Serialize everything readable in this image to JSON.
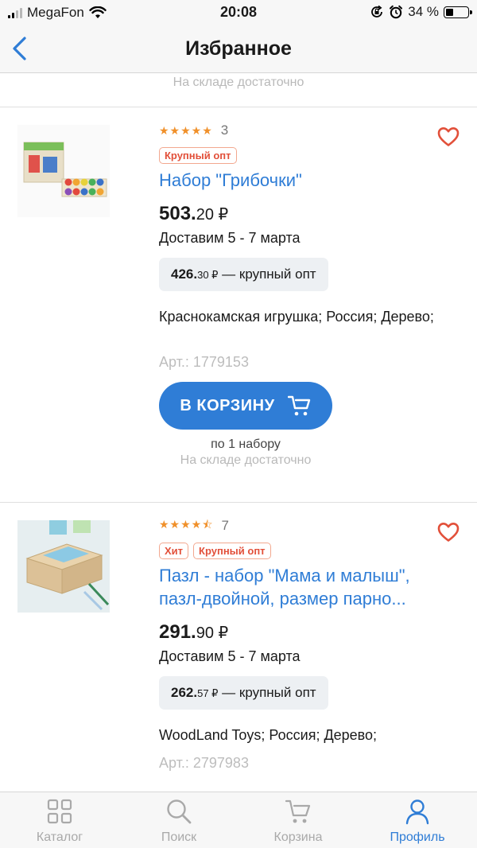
{
  "status_bar": {
    "carrier": "MegaFon",
    "time": "20:08",
    "battery": "34 %",
    "battery_level_percent": 34,
    "icons": [
      "signal-icon",
      "wifi-icon",
      "rotation-lock-icon",
      "alarm-icon",
      "battery-icon"
    ]
  },
  "nav": {
    "title": "Избранное",
    "back_icon": "chevron-left-icon"
  },
  "previous_item": {
    "stock": "На складе достаточно"
  },
  "products": [
    {
      "rating_stars": 5,
      "stars": "★★★★★",
      "rating_count": "3",
      "badges": [
        "Крупный опт"
      ],
      "name": "Набор \"Грибочки\"",
      "price_main": "503.",
      "price_kop": "20 ₽",
      "delivery": "Доставим 5 - 7 марта",
      "wholesale_main": "426.",
      "wholesale_kop": "30 ₽",
      "wholesale_label": " — крупный опт",
      "vendor": "Краснокамская игрушка; Россия; Дерево;",
      "sku": "Арт.: 1779153",
      "cart_button": "В КОРЗИНУ",
      "per_unit": "по 1 набору",
      "stock": "На складе достаточно",
      "favorite_icon": "heart-icon"
    },
    {
      "rating_stars": 4.5,
      "stars": "★★★★⯪",
      "rating_count": "7",
      "badges": [
        "Хит",
        "Крупный опт"
      ],
      "name_line1": "Пазл - набор \"Мама и малыш\",",
      "name_line2": "пазл-двойной, размер парно...",
      "price_main": "291.",
      "price_kop": "90 ₽",
      "delivery": "Доставим 5 - 7 марта",
      "wholesale_main": "262.",
      "wholesale_kop": "57 ₽",
      "wholesale_label": " — крупный опт",
      "vendor": "WoodLand Toys; Россия; Дерево;",
      "sku": "Арт.: 2797983",
      "favorite_icon": "heart-icon"
    }
  ],
  "tabs": [
    {
      "label": "Каталог",
      "icon": "grid-icon",
      "active": false
    },
    {
      "label": "Поиск",
      "icon": "search-icon",
      "active": false
    },
    {
      "label": "Корзина",
      "icon": "cart-icon",
      "active": false
    },
    {
      "label": "Профиль",
      "icon": "profile-icon",
      "active": true
    }
  ],
  "colors": {
    "accent": "#2f7dd6",
    "favorite": "#e2503a",
    "star": "#f0902a",
    "badge": "#e2503a"
  }
}
